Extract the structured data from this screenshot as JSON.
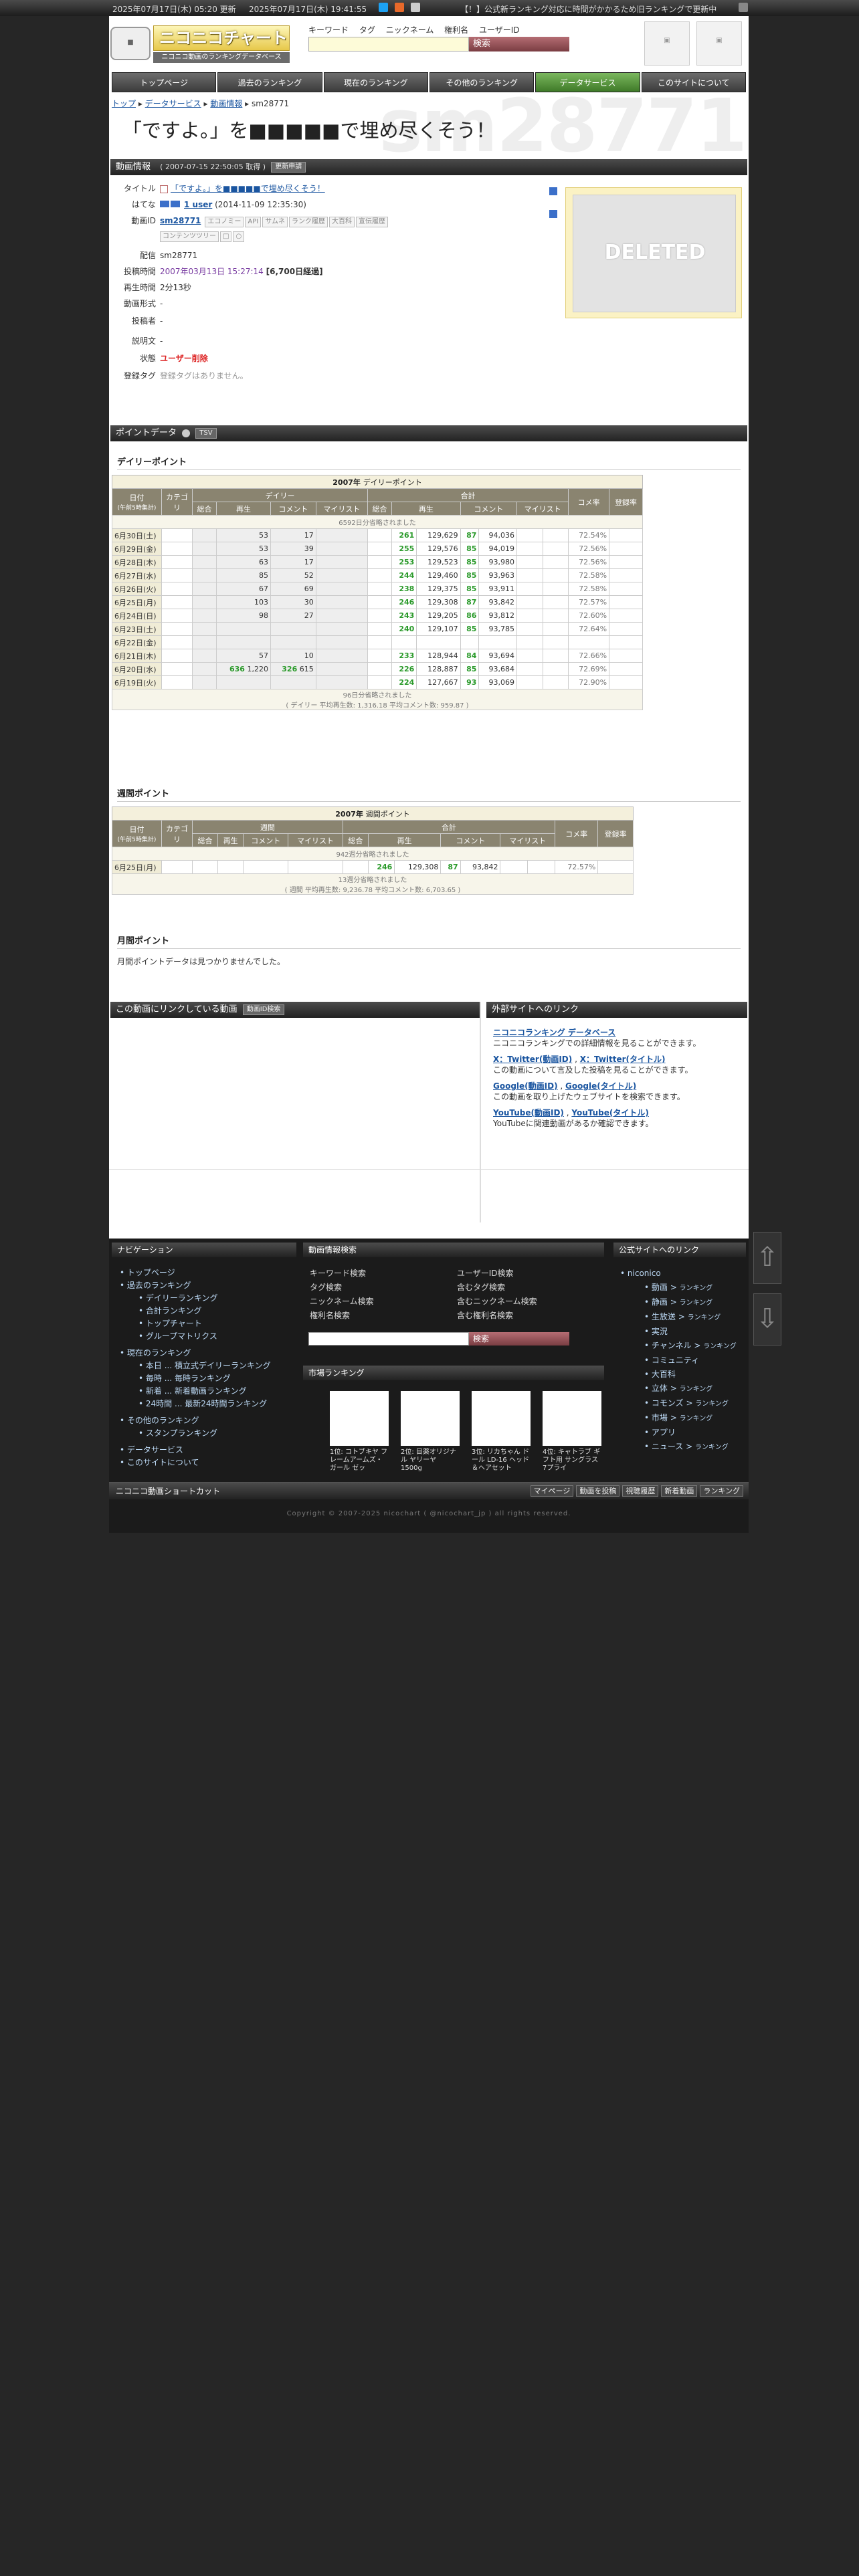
{
  "topbar": {
    "updated": "2025年07月17日(木) 05:20 更新",
    "now": "2025年07月17日(木) 19:41:55",
    "notice": "【！】公式新ランキング対応に時間がかかるため旧ランキングで更新中"
  },
  "logo": {
    "main": "ニコニコチャート",
    "sub": "ニコニコ動画のランキングデータベース"
  },
  "search": {
    "tabs": [
      "キーワード",
      "タグ",
      "ニックネーム",
      "権利名",
      "ユーザーID"
    ],
    "button": "検索"
  },
  "nav": {
    "items": [
      "トップページ",
      "過去のランキング",
      "現在のランキング",
      "その他のランキング",
      "データサービス",
      "このサイトについて"
    ],
    "active": "データサービス"
  },
  "breadcrumb": {
    "items": [
      "トップ",
      "データサービス",
      "動画情報"
    ],
    "current": "sm28771"
  },
  "page": {
    "title": "「ですよ。」を■■■■■で埋め尽くそう！",
    "watermark": "sm28771"
  },
  "video_info": {
    "header": "動画情報",
    "fetched": "( 2007-07-15 22:50:05 取得 )",
    "update_button": "更新申請",
    "rows": {
      "title_label": "タイトル",
      "title_value": "「ですよ。」を■■■■■で埋め尽くそう！",
      "hatena_label": "はてな",
      "hatena_users": "1 user",
      "hatena_date": "(2014-11-09 12:35:30)",
      "id_label": "動画ID",
      "id_value": "sm28771",
      "id_chips": [
        "エコノミー",
        "API",
        "サムネ",
        "ランク履歴",
        "大百科",
        "宣伝履歴"
      ],
      "id_chips2": [
        "コンテンツツリー"
      ],
      "delivery_label": "配信",
      "delivery_value": "sm28771",
      "posted_label": "投稿時間",
      "posted_value": "2007年03月13日 15:27:14",
      "posted_elapsed": "[6,700日経過]",
      "duration_label": "再生時間",
      "duration_value": "2分13秒",
      "format_label": "動画形式",
      "format_value": "-",
      "poster_label": "投稿者",
      "poster_value": "-",
      "desc_label": "説明文",
      "desc_value": "-",
      "status_label": "状態",
      "status_value": "ユーザー削除",
      "tags_label": "登録タグ",
      "tags_value": "登録タグはありません。"
    },
    "thumbnail_text": "DELETED"
  },
  "point_data": {
    "header": "ポイントデータ",
    "tsv_button": "TSV",
    "daily": {
      "section_title": "デイリーポイント",
      "caption_year": "2007年",
      "caption_label": "デイリーポイント",
      "col_date": "日付",
      "col_date_sub": "(午前5時集計)",
      "col_category": "カテゴリ",
      "group_daily": "デイリー",
      "group_total": "合計",
      "sub_cols": [
        "総合",
        "再生",
        "コメント",
        "マイリスト"
      ],
      "col_comment_rate": "コメ率",
      "col_registered": "登録率",
      "omitted_top": "6592日分省略されました",
      "omitted_bottom": "96日分省略されました",
      "average": "( デイリー 平均再生数: 1,316.18 平均コメント数: 959.87 )",
      "rows": [
        {
          "date": "6月30日(土)",
          "d_total": "",
          "d_play": "53",
          "d_comment": "17",
          "d_mylist": "",
          "t_total": "",
          "t_rank": "261",
          "t_play": "129,629",
          "t_rank2": "87",
          "t_comment": "94,036",
          "t_mylist": "",
          "rate": "72.54%"
        },
        {
          "date": "6月29日(金)",
          "d_total": "",
          "d_play": "53",
          "d_comment": "39",
          "d_mylist": "",
          "t_total": "",
          "t_rank": "255",
          "t_play": "129,576",
          "t_rank2": "85",
          "t_comment": "94,019",
          "t_mylist": "",
          "rate": "72.56%"
        },
        {
          "date": "6月28日(木)",
          "d_total": "",
          "d_play": "63",
          "d_comment": "17",
          "d_mylist": "",
          "t_total": "",
          "t_rank": "253",
          "t_play": "129,523",
          "t_rank2": "85",
          "t_comment": "93,980",
          "t_mylist": "",
          "rate": "72.56%"
        },
        {
          "date": "6月27日(水)",
          "d_total": "",
          "d_play": "85",
          "d_comment": "52",
          "d_mylist": "",
          "t_total": "",
          "t_rank": "244",
          "t_play": "129,460",
          "t_rank2": "85",
          "t_comment": "93,963",
          "t_mylist": "",
          "rate": "72.58%"
        },
        {
          "date": "6月26日(火)",
          "d_total": "",
          "d_play": "67",
          "d_comment": "69",
          "d_mylist": "",
          "t_total": "",
          "t_rank": "238",
          "t_play": "129,375",
          "t_rank2": "85",
          "t_comment": "93,911",
          "t_mylist": "",
          "rate": "72.58%"
        },
        {
          "date": "6月25日(月)",
          "d_total": "",
          "d_play": "103",
          "d_comment": "30",
          "d_mylist": "",
          "t_total": "",
          "t_rank": "246",
          "t_play": "129,308",
          "t_rank2": "87",
          "t_comment": "93,842",
          "t_mylist": "",
          "rate": "72.57%"
        },
        {
          "date": "6月24日(日)",
          "d_total": "",
          "d_play": "98",
          "d_comment": "27",
          "d_mylist": "",
          "t_total": "",
          "t_rank": "243",
          "t_play": "129,205",
          "t_rank2": "86",
          "t_comment": "93,812",
          "t_mylist": "",
          "rate": "72.60%"
        },
        {
          "date": "6月23日(土)",
          "d_total": "",
          "d_play": "",
          "d_comment": "",
          "d_mylist": "",
          "t_total": "",
          "t_rank": "240",
          "t_play": "129,107",
          "t_rank2": "85",
          "t_comment": "93,785",
          "t_mylist": "",
          "rate": "72.64%"
        },
        {
          "date": "6月22日(金)",
          "d_total": "",
          "d_play": "",
          "d_comment": "",
          "d_mylist": "",
          "t_total": "",
          "t_rank": "",
          "t_play": "",
          "t_rank2": "",
          "t_comment": "",
          "t_mylist": "",
          "rate": ""
        },
        {
          "date": "6月21日(木)",
          "d_total": "",
          "d_play": "57",
          "d_comment": "10",
          "d_mylist": "",
          "t_total": "",
          "t_rank": "233",
          "t_play": "128,944",
          "t_rank2": "84",
          "t_comment": "93,694",
          "t_mylist": "",
          "rate": "72.66%"
        },
        {
          "date": "6月20日(水)",
          "d_total": "",
          "d_play": "1,220",
          "d_rank": "636",
          "d_comment": "615",
          "d_rank2": "326",
          "d_mylist": "",
          "t_total": "",
          "t_rank": "226",
          "t_play": "128,887",
          "t_rank2": "85",
          "t_comment": "93,684",
          "t_mylist": "",
          "rate": "72.69%"
        },
        {
          "date": "6月19日(火)",
          "d_total": "",
          "d_play": "",
          "d_comment": "",
          "d_mylist": "",
          "t_total": "",
          "t_rank": "224",
          "t_play": "127,667",
          "t_rank2": "93",
          "t_comment": "93,069",
          "t_mylist": "",
          "rate": "72.90%"
        }
      ]
    },
    "weekly": {
      "section_title": "週間ポイント",
      "caption_year": "2007年",
      "caption_label": "週間ポイント",
      "group_weekly": "週間",
      "group_total": "合計",
      "omitted_top": "942週分省略されました",
      "omitted_bottom": "13週分省略されました",
      "average": "( 週間 平均再生数: 9,236.78 平均コメント数: 6,703.65 )",
      "row": {
        "date": "6月25日(月)",
        "t_rank": "246",
        "t_play": "129,308",
        "t_rank2": "87",
        "t_comment": "93,842",
        "rate": "72.57%"
      }
    },
    "monthly": {
      "section_title": "月間ポイント",
      "empty": "月間ポイントデータは見つかりませんでした。"
    }
  },
  "linking": {
    "header": "この動画にリンクしている動画",
    "button": "動画ID検索"
  },
  "external": {
    "header": "外部サイトへのリンク",
    "items": [
      {
        "links": [
          "ニコニコランキング データベース"
        ],
        "desc": "ニコニコランキングでの詳細情報を見ることができます。"
      },
      {
        "links": [
          "X：Twitter(動画ID)",
          "X：Twitter(タイトル)"
        ],
        "desc": "この動画について言及した投稿を見ることができます。"
      },
      {
        "links": [
          "Google(動画ID)",
          "Google(タイトル)"
        ],
        "desc": "この動画を取り上げたウェブサイトを検索できます。"
      },
      {
        "links": [
          "YouTube(動画ID)",
          "YouTube(タイトル)"
        ],
        "desc": "YouTubeに関連動画があるか確認できます。"
      }
    ]
  },
  "footer": {
    "navigation": {
      "header": "ナビゲーション",
      "items": [
        "トップページ",
        "過去のランキング",
        "デイリーランキング",
        "合計ランキング",
        "トップチャート",
        "グループマトリクス",
        "現在のランキング",
        "本日 ... 積立式デイリーランキング",
        "毎時 ... 毎時ランキング",
        "新着 ... 新着動画ランキング",
        "24時間 ... 最新24時間ランキング",
        "その他のランキング",
        "スタンプランキング",
        "データサービス",
        "このサイトについて"
      ]
    },
    "search": {
      "header": "動画情報検索",
      "items": [
        "キーワード検索",
        "ユーザーID検索",
        "タグ検索",
        "含むタグ検索",
        "ニックネーム検索",
        "含むニックネーム検索",
        "権利名検索",
        "含む権利名検索"
      ],
      "button": "検索"
    },
    "market": {
      "header": "市場ランキング",
      "items": [
        "1位: コトブキヤ フレームアームズ・ガール ゼッ",
        "2位: 目薬オリジナル ヤリーヤ 1500g",
        "3位: リカちゃん ドール LD-16 ヘッド＆ヘアセット",
        "4位: キャトラブ ギフト用 サングラス 7プライ"
      ]
    },
    "official": {
      "header": "公式サイトへのリンク",
      "root": "niconico",
      "items": [
        {
          "name": "動画",
          "sub": "ランキング"
        },
        {
          "name": "静画",
          "sub": "ランキング"
        },
        {
          "name": "生放送",
          "sub": "ランキング"
        },
        {
          "name": "実況",
          "sub": ""
        },
        {
          "name": "チャンネル",
          "sub": "ランキング"
        },
        {
          "name": "コミュニティ",
          "sub": ""
        },
        {
          "name": "大百科",
          "sub": ""
        },
        {
          "name": "立体",
          "sub": "ランキング"
        },
        {
          "name": "コモンズ",
          "sub": "ランキング"
        },
        {
          "name": "市場",
          "sub": "ランキング"
        },
        {
          "name": "アプリ",
          "sub": ""
        },
        {
          "name": "ニュース",
          "sub": "ランキング"
        }
      ]
    },
    "shortcut": {
      "label": "ニコニコ動画ショートカット",
      "links": [
        "マイページ",
        "動画を投稿",
        "視聴履歴",
        "新着動画",
        "ランキング"
      ]
    },
    "copyright": "Copyright © 2007-2025 nicochart ( @nicochart_jp ) all rights reserved."
  }
}
